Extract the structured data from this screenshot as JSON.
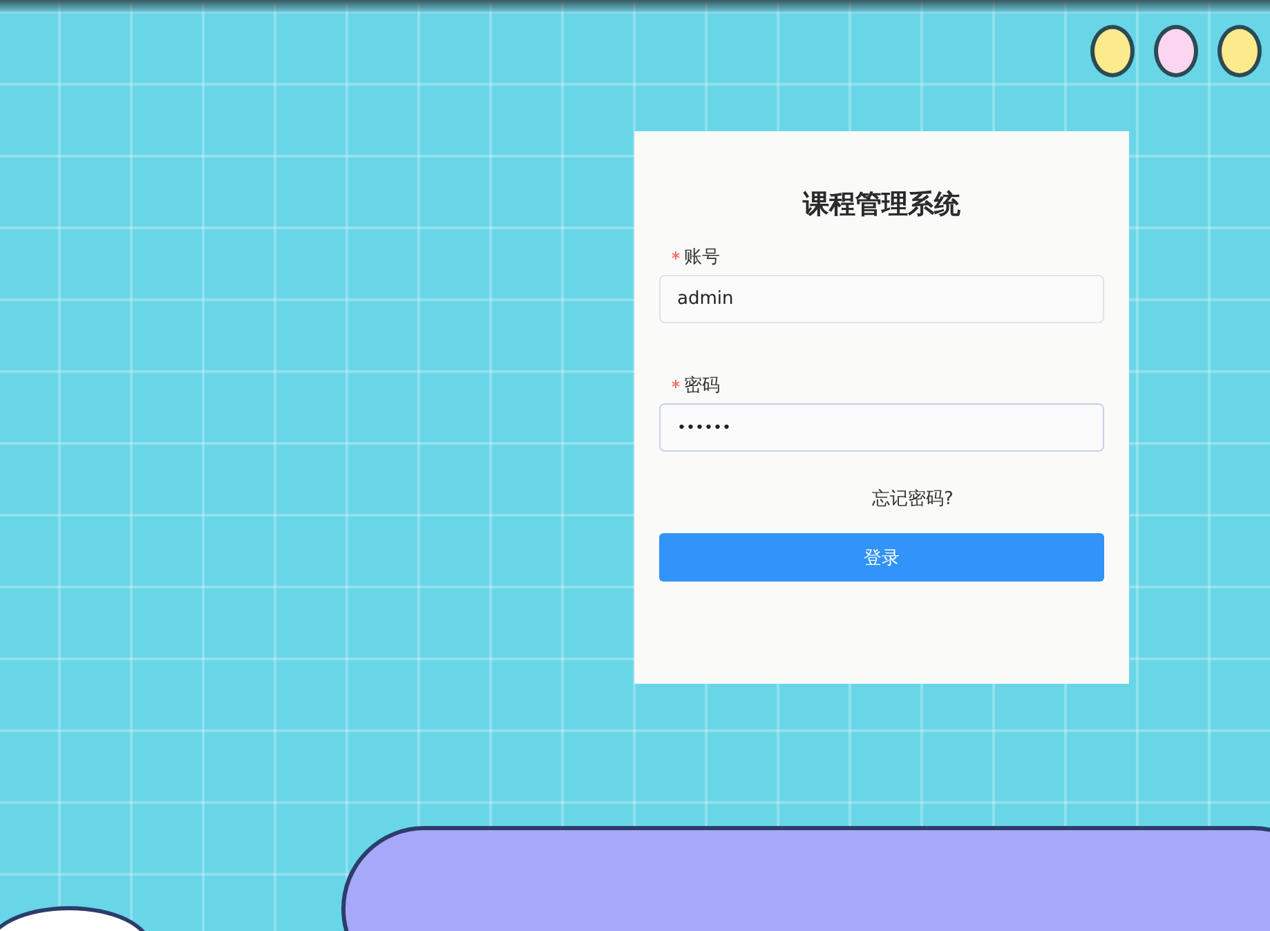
{
  "form": {
    "title": "课程管理系统",
    "fields": [
      {
        "label": "账号",
        "required": true,
        "kind": "text",
        "value": "admin"
      },
      {
        "label": "密码",
        "required": true,
        "kind": "password",
        "value": "••••••"
      }
    ],
    "forgot_link": "忘记密码?",
    "submit_button": "登录"
  },
  "decor_dots": [
    {
      "color": "#fbeb8c"
    },
    {
      "color": "#fcd6f0"
    },
    {
      "color": "#fbeb8c"
    }
  ]
}
